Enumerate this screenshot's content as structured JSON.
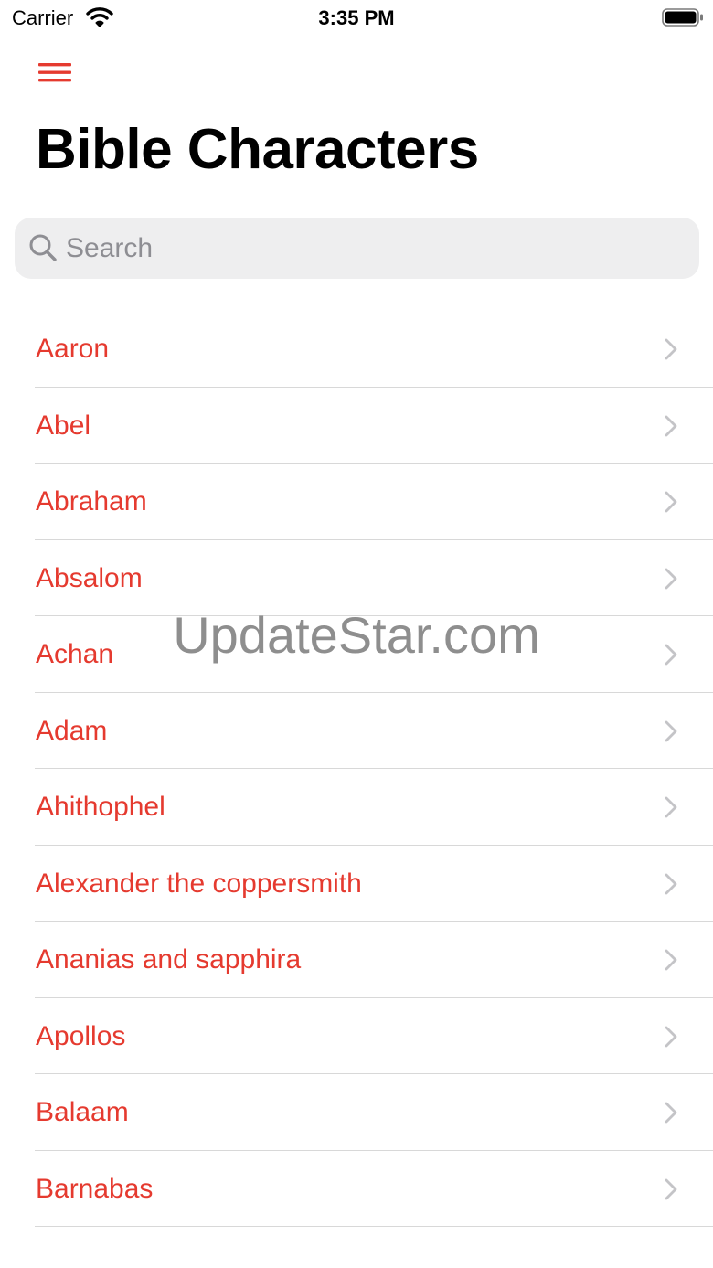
{
  "status_bar": {
    "carrier": "Carrier",
    "time": "3:35 PM"
  },
  "header": {
    "menu_icon": "hamburger-menu-icon",
    "title": "Bible Characters"
  },
  "search": {
    "placeholder": "Search",
    "value": "",
    "icon": "search-icon"
  },
  "list": {
    "items": [
      {
        "label": "Aaron"
      },
      {
        "label": "Abel"
      },
      {
        "label": "Abraham"
      },
      {
        "label": "Absalom"
      },
      {
        "label": "Achan"
      },
      {
        "label": "Adam"
      },
      {
        "label": "Ahithophel"
      },
      {
        "label": "Alexander the coppersmith"
      },
      {
        "label": "Ananias and sapphira"
      },
      {
        "label": "Apollos"
      },
      {
        "label": "Balaam"
      },
      {
        "label": "Barnabas"
      }
    ]
  },
  "watermark": "UpdateStar.com",
  "colors": {
    "accent": "#e53a2f",
    "search_background": "#eeeeef",
    "placeholder": "#8e8e93",
    "chevron": "#c4c4c7",
    "separator": "#d8d8d8"
  }
}
